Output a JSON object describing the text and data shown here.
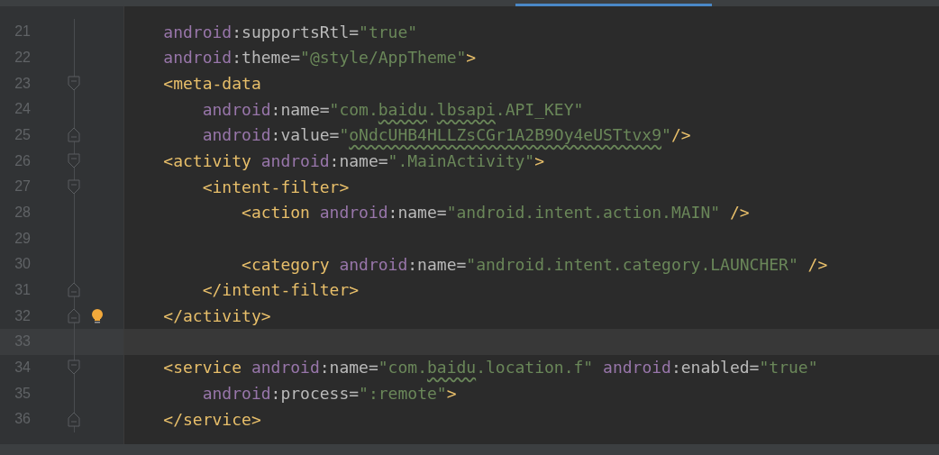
{
  "editor": {
    "lines": [
      {
        "number": "21",
        "tokens": [
          {
            "kind": "ns",
            "text": "    android"
          },
          {
            "kind": "attr",
            "text": ":supportsRtl="
          },
          {
            "kind": "value",
            "text": "\"true\""
          }
        ]
      },
      {
        "number": "22",
        "tokens": [
          {
            "kind": "ns",
            "text": "    android"
          },
          {
            "kind": "attr",
            "text": ":theme="
          },
          {
            "kind": "value",
            "text": "\"@style/AppTheme\""
          },
          {
            "kind": "tag",
            "text": ">"
          }
        ]
      },
      {
        "number": "23",
        "fold_start": true,
        "tokens": [
          {
            "kind": "tag",
            "text": "    <meta-data"
          }
        ]
      },
      {
        "number": "24",
        "tokens": [
          {
            "kind": "ns",
            "text": "        android"
          },
          {
            "kind": "attr",
            "text": ":name="
          },
          {
            "kind": "value",
            "text": "\"com."
          },
          {
            "kind": "value",
            "text": "baidu",
            "typo": true
          },
          {
            "kind": "value",
            "text": "."
          },
          {
            "kind": "value",
            "text": "lbsapi",
            "typo": true
          },
          {
            "kind": "value",
            "text": ".API_KEY\""
          }
        ]
      },
      {
        "number": "25",
        "fold_end": true,
        "tokens": [
          {
            "kind": "ns",
            "text": "        android"
          },
          {
            "kind": "attr",
            "text": ":value="
          },
          {
            "kind": "value",
            "text": "\""
          },
          {
            "kind": "value",
            "text": "oNdcUHB4HLLZsCGr1A2B9Oy4eUSTtvx9",
            "typo": true
          },
          {
            "kind": "value",
            "text": "\""
          },
          {
            "kind": "tag",
            "text": "/>"
          }
        ]
      },
      {
        "number": "26",
        "fold_start": true,
        "tokens": [
          {
            "kind": "tag",
            "text": "    <activity "
          },
          {
            "kind": "ns",
            "text": "android"
          },
          {
            "kind": "attr",
            "text": ":name="
          },
          {
            "kind": "value",
            "text": "\".MainActivity\""
          },
          {
            "kind": "tag",
            "text": ">"
          }
        ]
      },
      {
        "number": "27",
        "fold_start": true,
        "tokens": [
          {
            "kind": "tag",
            "text": "        <intent-filter>"
          }
        ]
      },
      {
        "number": "28",
        "tokens": [
          {
            "kind": "tag",
            "text": "            <action "
          },
          {
            "kind": "ns",
            "text": "android"
          },
          {
            "kind": "attr",
            "text": ":name="
          },
          {
            "kind": "value",
            "text": "\"android.intent.action.MAIN\""
          },
          {
            "kind": "tag",
            "text": " />"
          }
        ]
      },
      {
        "number": "29"
      },
      {
        "number": "30",
        "tokens": [
          {
            "kind": "tag",
            "text": "            <category "
          },
          {
            "kind": "ns",
            "text": "android"
          },
          {
            "kind": "attr",
            "text": ":name="
          },
          {
            "kind": "value",
            "text": "\"android.intent.category.LAUNCHER\""
          },
          {
            "kind": "tag",
            "text": " />"
          }
        ]
      },
      {
        "number": "31",
        "fold_end": true,
        "tokens": [
          {
            "kind": "tag",
            "text": "        </intent-filter>"
          }
        ]
      },
      {
        "number": "32",
        "fold_end": true,
        "bulb": true,
        "tokens": [
          {
            "kind": "tag",
            "text": "    </activity>"
          }
        ]
      },
      {
        "number": "33",
        "current": true
      },
      {
        "number": "34",
        "fold_start": true,
        "tokens": [
          {
            "kind": "tag",
            "text": "    <service "
          },
          {
            "kind": "ns",
            "text": "android"
          },
          {
            "kind": "attr",
            "text": ":name="
          },
          {
            "kind": "value",
            "text": "\"com."
          },
          {
            "kind": "value",
            "text": "baidu",
            "typo": true
          },
          {
            "kind": "value",
            "text": ".location.f\" "
          },
          {
            "kind": "ns",
            "text": "android"
          },
          {
            "kind": "attr",
            "text": ":enabled="
          },
          {
            "kind": "value",
            "text": "\"true\""
          }
        ]
      },
      {
        "number": "35",
        "tokens": [
          {
            "kind": "ns",
            "text": "        android"
          },
          {
            "kind": "attr",
            "text": ":process="
          },
          {
            "kind": "value",
            "text": "\":remote\""
          },
          {
            "kind": "tag",
            "text": ">"
          }
        ]
      },
      {
        "number": "36",
        "fold_end": true,
        "tokens": [
          {
            "kind": "tag",
            "text": "    </service>"
          }
        ]
      }
    ]
  }
}
